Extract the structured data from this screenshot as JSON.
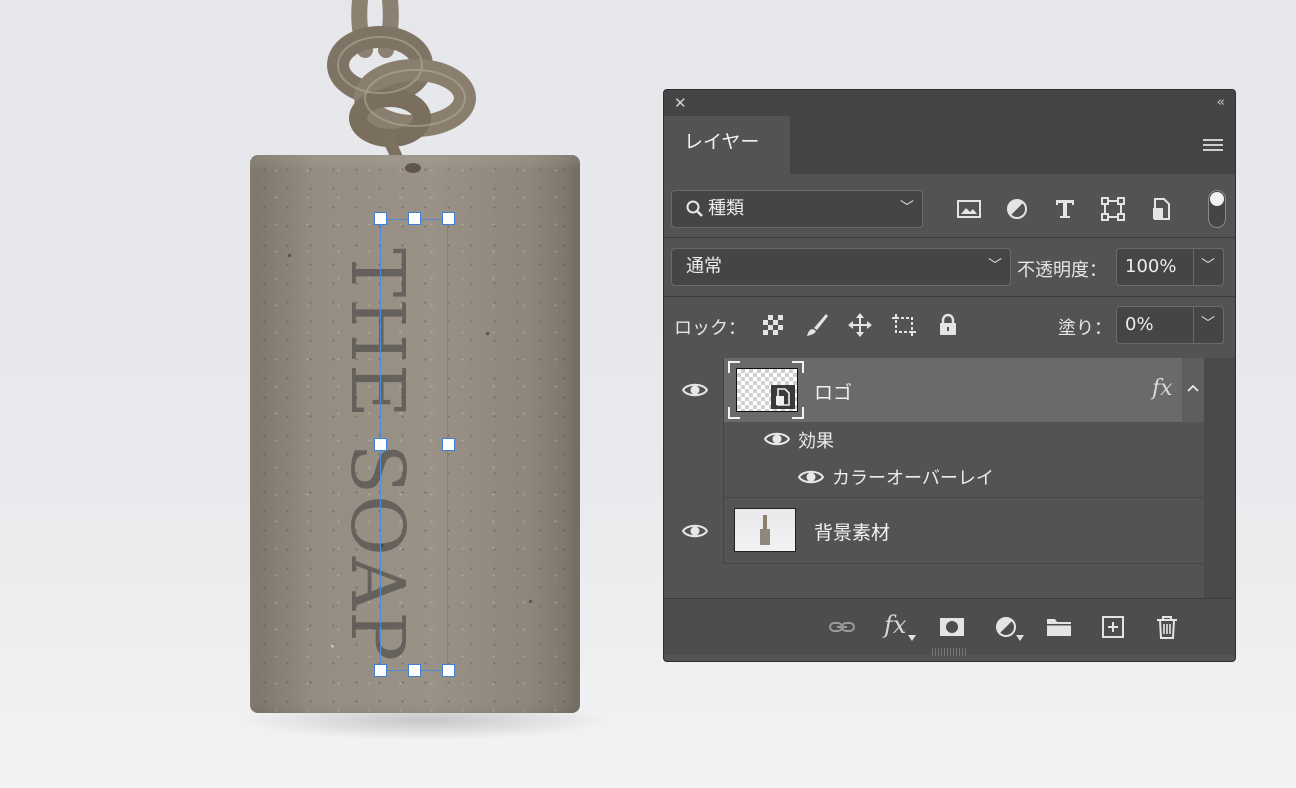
{
  "canvas": {
    "logo_text": "THE SOAP"
  },
  "panel": {
    "tab_label": "レイヤー",
    "filter": {
      "value": "種類"
    },
    "blend_mode": {
      "value": "通常"
    },
    "opacity": {
      "label": "不透明度：",
      "value": "100%"
    },
    "lock": {
      "label": "ロック："
    },
    "fill": {
      "label": "塗り：",
      "value": "0%"
    },
    "layers": [
      {
        "name": "ロゴ",
        "selected": true,
        "has_fx": true,
        "fx_label": "fx",
        "effects_label": "効果",
        "effects": [
          "カラーオーバーレイ"
        ]
      },
      {
        "name": "背景素材",
        "selected": false
      }
    ],
    "bottom_fx_label": "fx"
  },
  "colors": {
    "panel_bg": "#535353",
    "selected_row": "#6a6a6a",
    "selection_blue": "#3f7fd6"
  }
}
